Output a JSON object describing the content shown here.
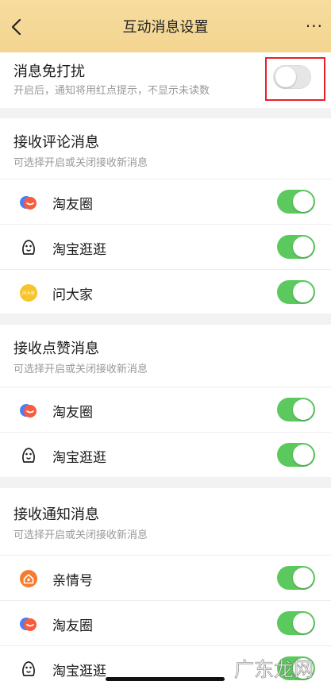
{
  "header": {
    "title": "互动消息设置",
    "more": "···"
  },
  "dnd": {
    "title": "消息免打扰",
    "subtitle": "开启后，通知将用红点提示，不显示未读数",
    "enabled": false
  },
  "comment": {
    "title": "接收评论消息",
    "subtitle": "可选择开启或关闭接收新消息",
    "items": [
      {
        "label": "淘友圈",
        "icon": "taoyouquan-icon",
        "enabled": true
      },
      {
        "label": "淘宝逛逛",
        "icon": "guangguang-icon",
        "enabled": true
      },
      {
        "label": "问大家",
        "icon": "wendajia-icon",
        "icon_text": "问大家",
        "enabled": true
      }
    ]
  },
  "like": {
    "title": "接收点赞消息",
    "subtitle": "可选择开启或关闭接收新消息",
    "items": [
      {
        "label": "淘友圈",
        "icon": "taoyouquan-icon",
        "enabled": true
      },
      {
        "label": "淘宝逛逛",
        "icon": "guangguang-icon",
        "enabled": true
      }
    ]
  },
  "notice": {
    "title": "接收通知消息",
    "subtitle": "可选择开启或关闭接收新消息",
    "items": [
      {
        "label": "亲情号",
        "icon": "qinqinghao-icon",
        "enabled": true
      },
      {
        "label": "淘友圈",
        "icon": "taoyouquan-icon",
        "enabled": true
      },
      {
        "label": "淘宝逛逛",
        "icon": "guangguang-icon",
        "enabled": true
      }
    ]
  },
  "watermark": {
    "text": "广东龙网"
  },
  "colors": {
    "header_bg": "#f3d590",
    "toggle_on": "#5cc95e",
    "toggle_off": "#e6e6e6",
    "highlight": "#e8202a"
  }
}
